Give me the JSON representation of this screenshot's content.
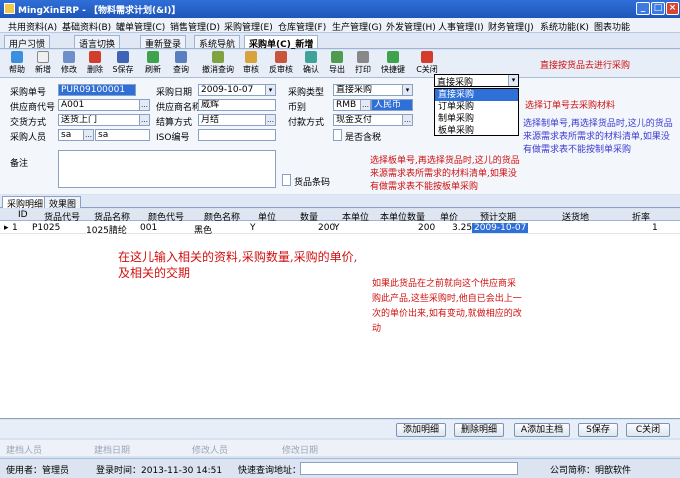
{
  "window": {
    "title": "MingXinERP - 【物料需求计划(&I)】"
  },
  "menu": [
    "共用资料(A)",
    "基础资料(B)",
    "罐单管理(C)",
    "销售管理(D)",
    "采购管理(E)",
    "仓库管理(F)",
    "生产管理(G)",
    "外发管理(H)",
    "人事管理(I)",
    "财务管理(J)",
    "系统功能(K)",
    "图表功能"
  ],
  "tabs": [
    "用户习惯",
    "语言切换",
    "重新登录",
    "系统导航",
    "采购单(C)_新增"
  ],
  "toolbar": [
    "帮助",
    "新增",
    "修改",
    "删除",
    "S保存",
    "刷新",
    "查询",
    "撤消查询",
    "审核",
    "反审核",
    "确认",
    "导出",
    "打印",
    "快捷键",
    "C关闭"
  ],
  "form": {
    "order_no_label": "采购单号",
    "order_no": "PUR09100001",
    "date_label": "采购日期",
    "date": "2009-10-07",
    "type_label": "采购类型",
    "type": "直接采购",
    "supplier_code_label": "供应商代号",
    "supplier_code": "A001",
    "supplier_name_label": "供应商名称",
    "supplier_name": "威辉",
    "currency_label": "币别",
    "currency_code": "RMB",
    "currency_name": "人民币",
    "delivery_label": "交货方式",
    "delivery": "送货上门",
    "settle_label": "结算方式",
    "settle": "月结",
    "payment_label": "付款方式",
    "payment": "现金支付",
    "buyer_label": "采购人员",
    "buyer_code": "sa",
    "buyer_name": "sa",
    "iso_label": "ISO编号",
    "tax_label": "是否含税",
    "remark_label": "备注",
    "barcode_label": "货品条码"
  },
  "dropdown": {
    "current": "直接采购",
    "options": [
      "直接采购",
      "订单采购",
      "制单采购",
      "板单采购"
    ]
  },
  "notes": {
    "n1": "直接按货品去进行采购",
    "n2": "选择订单号去采购材料",
    "n3": "选择制单号,再选择货品时,这儿的货品来源需求表所需求的材料清单,如果没有做需求表不能按制单采购",
    "n4": "选择板单号,再选择货品时,这儿的货品来源需求表所需求的材料清单,如果没有做需求表不能按板单采购",
    "n5": "在这儿输入相关的资料,采购数量,采购的单价,及相关的交期",
    "n6": "如果此货品在之前就向这个供应商采购此产品,这些采购时,他自已会出上一次的单价出来,如有变动,就做相应的改动"
  },
  "inner_tabs": [
    "采购明细",
    "效果图"
  ],
  "grid": {
    "headers": [
      "ID",
      "货品代号",
      "货品名称",
      "颜色代号",
      "颜色名称",
      "单位",
      "数量",
      "本单位",
      "本单位数量",
      "单价",
      "预计交期",
      "送货地",
      "折率"
    ],
    "rows": [
      [
        "1",
        "P1025",
        "1025腈纶",
        "001",
        "黑色",
        "Y",
        "200",
        "Y",
        "200",
        "3.25",
        "2009-10-07",
        "",
        "1"
      ]
    ]
  },
  "buttons": [
    "添加明细",
    "删除明细",
    "A添加主档",
    "S保存",
    "C关闭"
  ],
  "audit": [
    "建档人员",
    "建档日期",
    "修改人员",
    "修改日期"
  ],
  "status": {
    "user": "使用者：管理员",
    "login": "登录时间：2013-11-30 14:51",
    "quick": "快速查询地址：",
    "company": "公司简称：明歆软件"
  }
}
